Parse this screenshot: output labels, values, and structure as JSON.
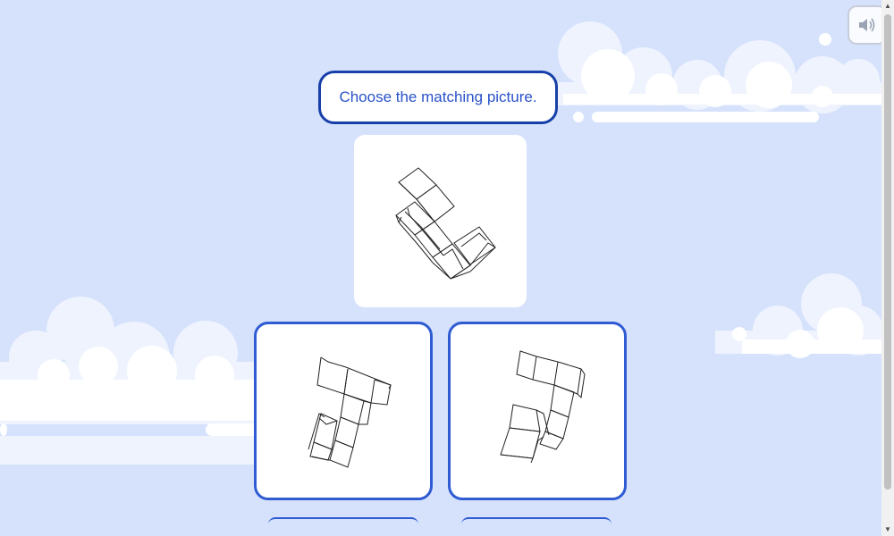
{
  "prompt": {
    "text": "Choose the matching picture."
  },
  "reference_image": {
    "icon": "cube-structure-reference"
  },
  "choices": [
    {
      "id": "a",
      "icon": "cube-structure-option-a"
    },
    {
      "id": "b",
      "icon": "cube-structure-option-b"
    }
  ],
  "sound_button": {
    "icon": "speaker-icon"
  },
  "colors": {
    "background": "#d6e2fc",
    "accent": "#2f5bd3",
    "prompt_text": "#2a52c9"
  }
}
